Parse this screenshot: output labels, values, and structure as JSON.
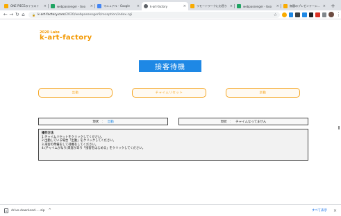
{
  "browser": {
    "tabs": [
      {
        "title": "ONE PIECEのイラスト",
        "color": "#f9ab00"
      },
      {
        "title": "webpassenger - Goo",
        "color": "#1fa463"
      },
      {
        "title": "マニュアル - Google ",
        "color": "#4285f4"
      },
      {
        "title": "k-art-factory",
        "color": "#5f6368"
      },
      {
        "title": "リモートワークにお困り",
        "color": "#f9ab00"
      },
      {
        "title": "webpassenger - Goo",
        "color": "#1fa463"
      },
      {
        "title": "無題のプレゼンテーション",
        "color": "#f9ab00"
      }
    ],
    "new_tab": "+",
    "url_host": "k-art-factory.com",
    "url_path": "/2020/webpassenger9/reception/index.cgi",
    "ext_colors": [
      "#f9ab00",
      "#1e88e5",
      "#3c4043",
      "#1e88e5",
      "#202124",
      "#d93025",
      "#80868b"
    ]
  },
  "page": {
    "logo_top": "2020 Lake",
    "logo_main": "k-art-factory",
    "wait_button": "接客待機",
    "controls": {
      "checkin": "出勤",
      "chime_reset": "チャイムリセット",
      "checkout": "退勤"
    },
    "status_left": {
      "label": "現状",
      "sep": "：",
      "value": "出勤"
    },
    "status_right": {
      "label": "現状",
      "sep": "：",
      "value": "チャイムなってません"
    },
    "instructions": {
      "heading": "操作方法",
      "lines": [
        "1.チャイムリセットをクリックしてください。",
        "2.出勤している場合「出勤」をクリックしてください。",
        "3.来客の準備をして待機をしてください。",
        "4.(チャイムがなり)来客があり「接客をはじめる」をクリックしてください。"
      ]
    }
  },
  "download_bar": {
    "file_name": "drive-download-....zip",
    "show_all": "すべて表示",
    "close": "×"
  }
}
